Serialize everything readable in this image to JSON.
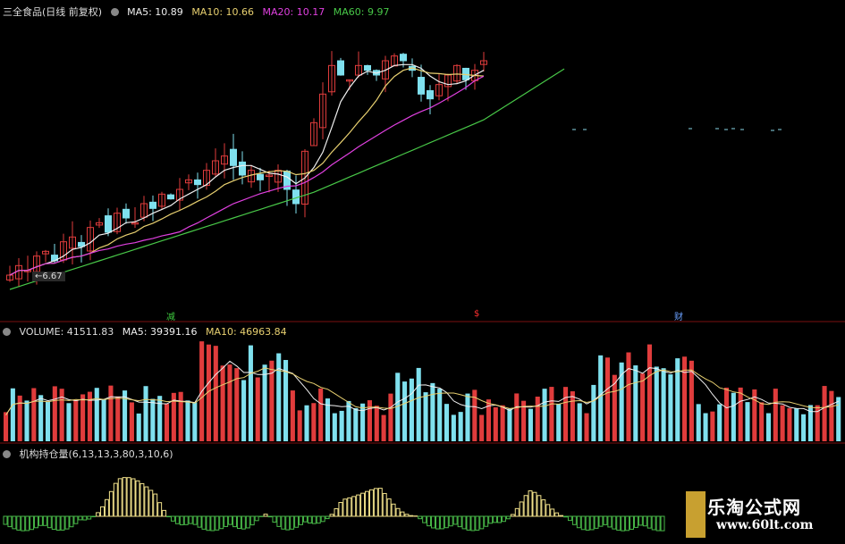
{
  "headers": {
    "price": {
      "title": "三全食品(日线 前复权)",
      "ma5": "MA5: 10.89",
      "ma10": "MA10: 10.66",
      "ma20": "MA20: 10.17",
      "ma60": "MA60: 9.97"
    },
    "volume": {
      "title": "VOLUME: 41511.83",
      "ma5": "MA5: 39391.16",
      "ma10": "MA10: 46963.84"
    },
    "indicator": {
      "title": "机构持仓量(6,13,13,3,80,3,10,6)"
    }
  },
  "price_low_label": "6.67",
  "markers": [
    {
      "text": "减",
      "color": "#3ec83e"
    },
    {
      "text": "$",
      "color": "#ff3030"
    },
    {
      "text": "财",
      "color": "#6aa0ff"
    }
  ],
  "colors": {
    "up": "#e03c3c",
    "down": "#7fe0ee",
    "ma5": "#f0f0f0",
    "ma10": "#e8d070",
    "ma20": "#e040e0",
    "ma60": "#48c848",
    "ind_pos": "#f0e08a",
    "ind_neg": "#48b848"
  },
  "watermark": {
    "title": "乐淘公式网",
    "url": "www.60lt.com"
  },
  "chart_data": [
    {
      "type": "candlestick",
      "title": "三全食品(日线 前复权)",
      "series": [
        {
          "name": "MA5",
          "last": 10.89
        },
        {
          "name": "MA10",
          "last": 10.66
        },
        {
          "name": "MA20",
          "last": 10.17
        },
        {
          "name": "MA60",
          "last": 9.97
        }
      ],
      "annotations": [
        "6.67"
      ],
      "close": [
        6.8,
        7.0,
        6.9,
        7.2,
        7.3,
        7.1,
        7.5,
        7.6,
        7.4,
        7.8,
        7.9,
        7.7,
        8.1,
        8.0,
        7.9,
        8.3,
        8.2,
        8.5,
        8.4,
        8.6,
        8.8,
        8.7,
        9.0,
        9.2,
        9.3,
        9.1,
        8.9,
        9.0,
        8.8,
        8.9,
        9.0,
        8.6,
        8.3,
        9.4,
        10.0,
        10.6,
        11.2,
        11.0,
        10.9,
        11.2,
        11.1,
        11.0,
        11.3,
        11.4,
        11.3,
        11.1,
        10.6,
        10.5,
        10.8,
        11.0,
        11.2,
        10.9,
        11.1,
        11.3
      ]
    },
    {
      "type": "bar",
      "title": "VOLUME",
      "series": [
        {
          "name": "VOLUME",
          "last": 41511.83
        },
        {
          "name": "MA5",
          "last": 39391.16
        },
        {
          "name": "MA10",
          "last": 46963.84
        }
      ]
    },
    {
      "type": "bar",
      "title": "机构持仓量(6,13,13,3,80,3,10,6)",
      "series": [
        {
          "name": "机构持仓量"
        }
      ]
    }
  ]
}
